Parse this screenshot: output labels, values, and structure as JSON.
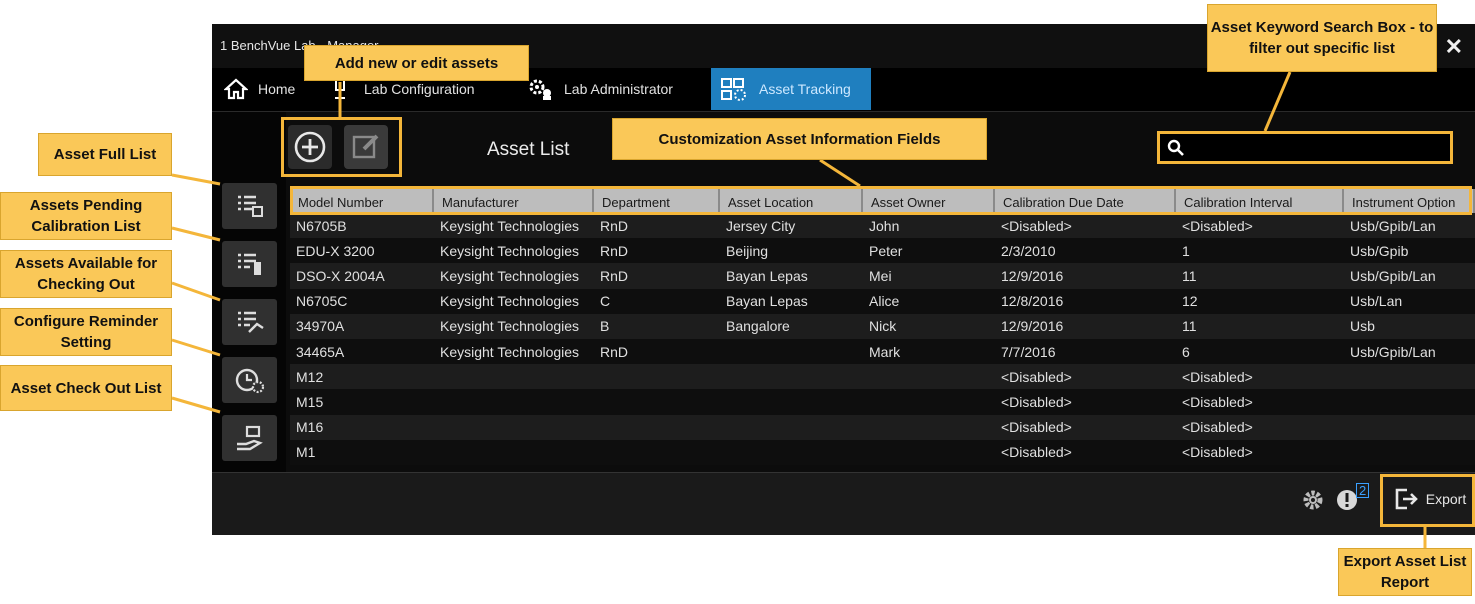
{
  "app": {
    "title": "1 BenchVue Lab - Manager",
    "close_glyph": "✕",
    "tabs": [
      {
        "label": "Home",
        "icon": "home-icon"
      },
      {
        "label": "Lab Configuration",
        "icon": "lab-config-icon"
      },
      {
        "label": "Lab Administrator",
        "icon": "admin-gear-icon"
      },
      {
        "label": "Asset Tracking",
        "icon": "asset-tracking-icon",
        "active": true
      }
    ],
    "accent_color": "#1f7fbf"
  },
  "asset_list": {
    "title": "Asset List",
    "columns": [
      "Model Number",
      "Manufacturer",
      "Department",
      "Asset Location",
      "Asset Owner",
      "Calibration Due Date",
      "Calibration Interval",
      "Instrument Option"
    ],
    "rows": [
      [
        "N6705B",
        "Keysight Technologies",
        "RnD",
        "Jersey City",
        "John",
        "<Disabled>",
        "<Disabled>",
        "Usb/Gpib/Lan"
      ],
      [
        "EDU-X 3200",
        "Keysight Technologies",
        "RnD",
        "Beijing",
        "Peter",
        "2/3/2010",
        "1",
        "Usb/Gpib"
      ],
      [
        "DSO-X 2004A",
        "Keysight Technologies",
        "RnD",
        "Bayan Lepas",
        "Mei",
        "12/9/2016",
        "11",
        "Usb/Gpib/Lan"
      ],
      [
        "N6705C",
        "Keysight Technologies",
        "C",
        "Bayan Lepas",
        "Alice",
        "12/8/2016",
        "12",
        "Usb/Lan"
      ],
      [
        "34970A",
        "Keysight Technologies",
        "B",
        "Bangalore",
        "Nick",
        "12/9/2016",
        "11",
        "Usb"
      ],
      [
        "34465A",
        "Keysight Technologies",
        "RnD",
        "",
        "Mark",
        "7/7/2016",
        "6",
        "Usb/Gpib/Lan"
      ],
      [
        "M12",
        "",
        "",
        "",
        "",
        "<Disabled>",
        "<Disabled>",
        ""
      ],
      [
        "M15",
        "",
        "",
        "",
        "",
        "<Disabled>",
        "<Disabled>",
        ""
      ],
      [
        "M16",
        "",
        "",
        "",
        "",
        "<Disabled>",
        "<Disabled>",
        ""
      ],
      [
        "M1",
        "",
        "",
        "",
        "",
        "<Disabled>",
        "<Disabled>",
        ""
      ]
    ]
  },
  "footer": {
    "export_label": "Export",
    "notification_count": "2"
  },
  "callouts": {
    "add_edit": "Add new or edit assets",
    "search_box": "Asset Keyword Search Box - to filter out specific list",
    "fields": "Customization Asset Information Fields",
    "full_list": "Asset Full List",
    "pending": "Assets Pending Calibration List",
    "available": "Assets Available for Checking Out",
    "reminder": "Configure Reminder Setting",
    "checkout": "Asset Check Out List",
    "export": "Export Asset List Report"
  },
  "callout_color": "#fac858"
}
